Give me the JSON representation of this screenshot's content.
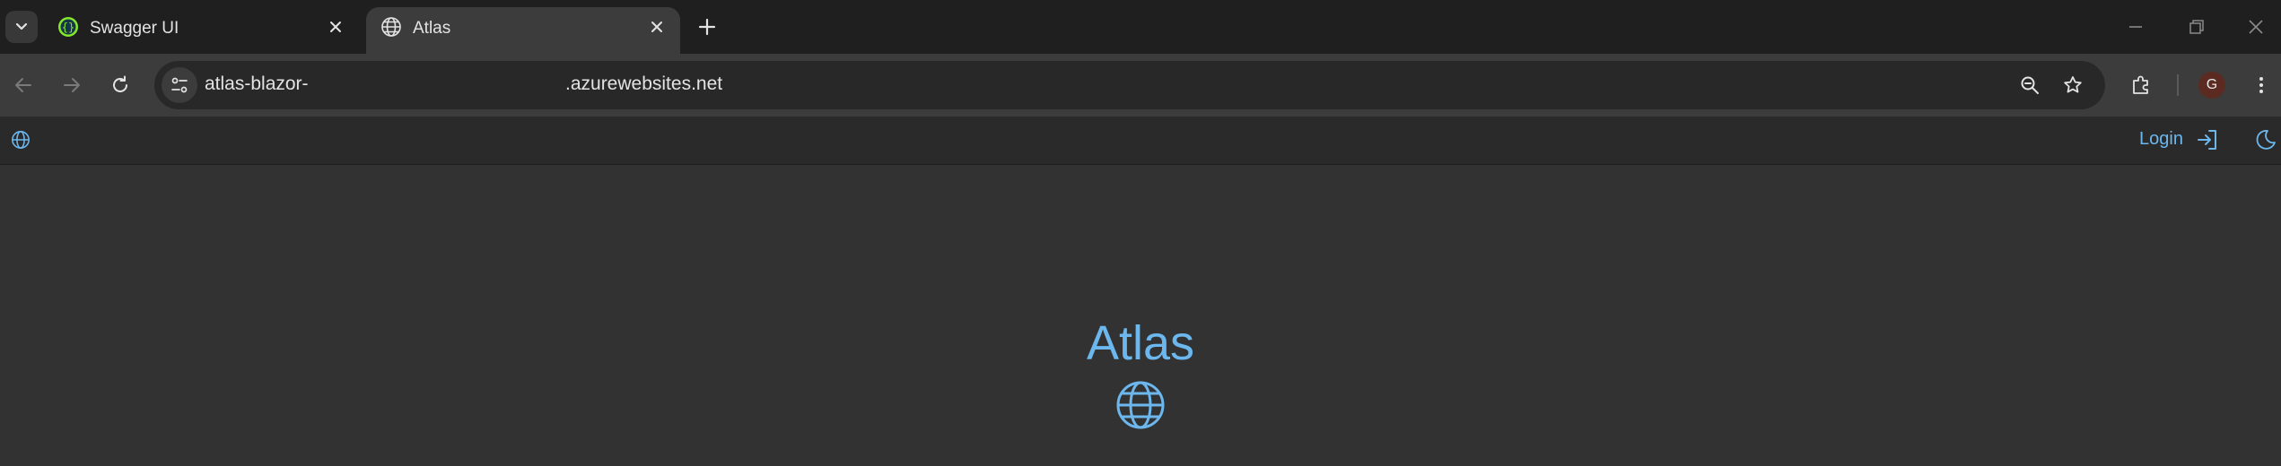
{
  "browser": {
    "tabs": [
      {
        "title": "Swagger UI",
        "active": false,
        "favicon": "swagger-icon"
      },
      {
        "title": "Atlas",
        "active": true,
        "favicon": "globe-icon"
      }
    ],
    "address_bar": {
      "url_prefix": "atlas-blazor-",
      "url_suffix": ".azurewebsites.net"
    },
    "profile_initial": "G"
  },
  "app": {
    "login_label": "Login",
    "hero_title": "Atlas"
  },
  "colors": {
    "accent": "#6cb8ee",
    "page_background": "#323232",
    "appbar_background": "#2a2a2a",
    "swagger_green": "#85ea2d"
  }
}
